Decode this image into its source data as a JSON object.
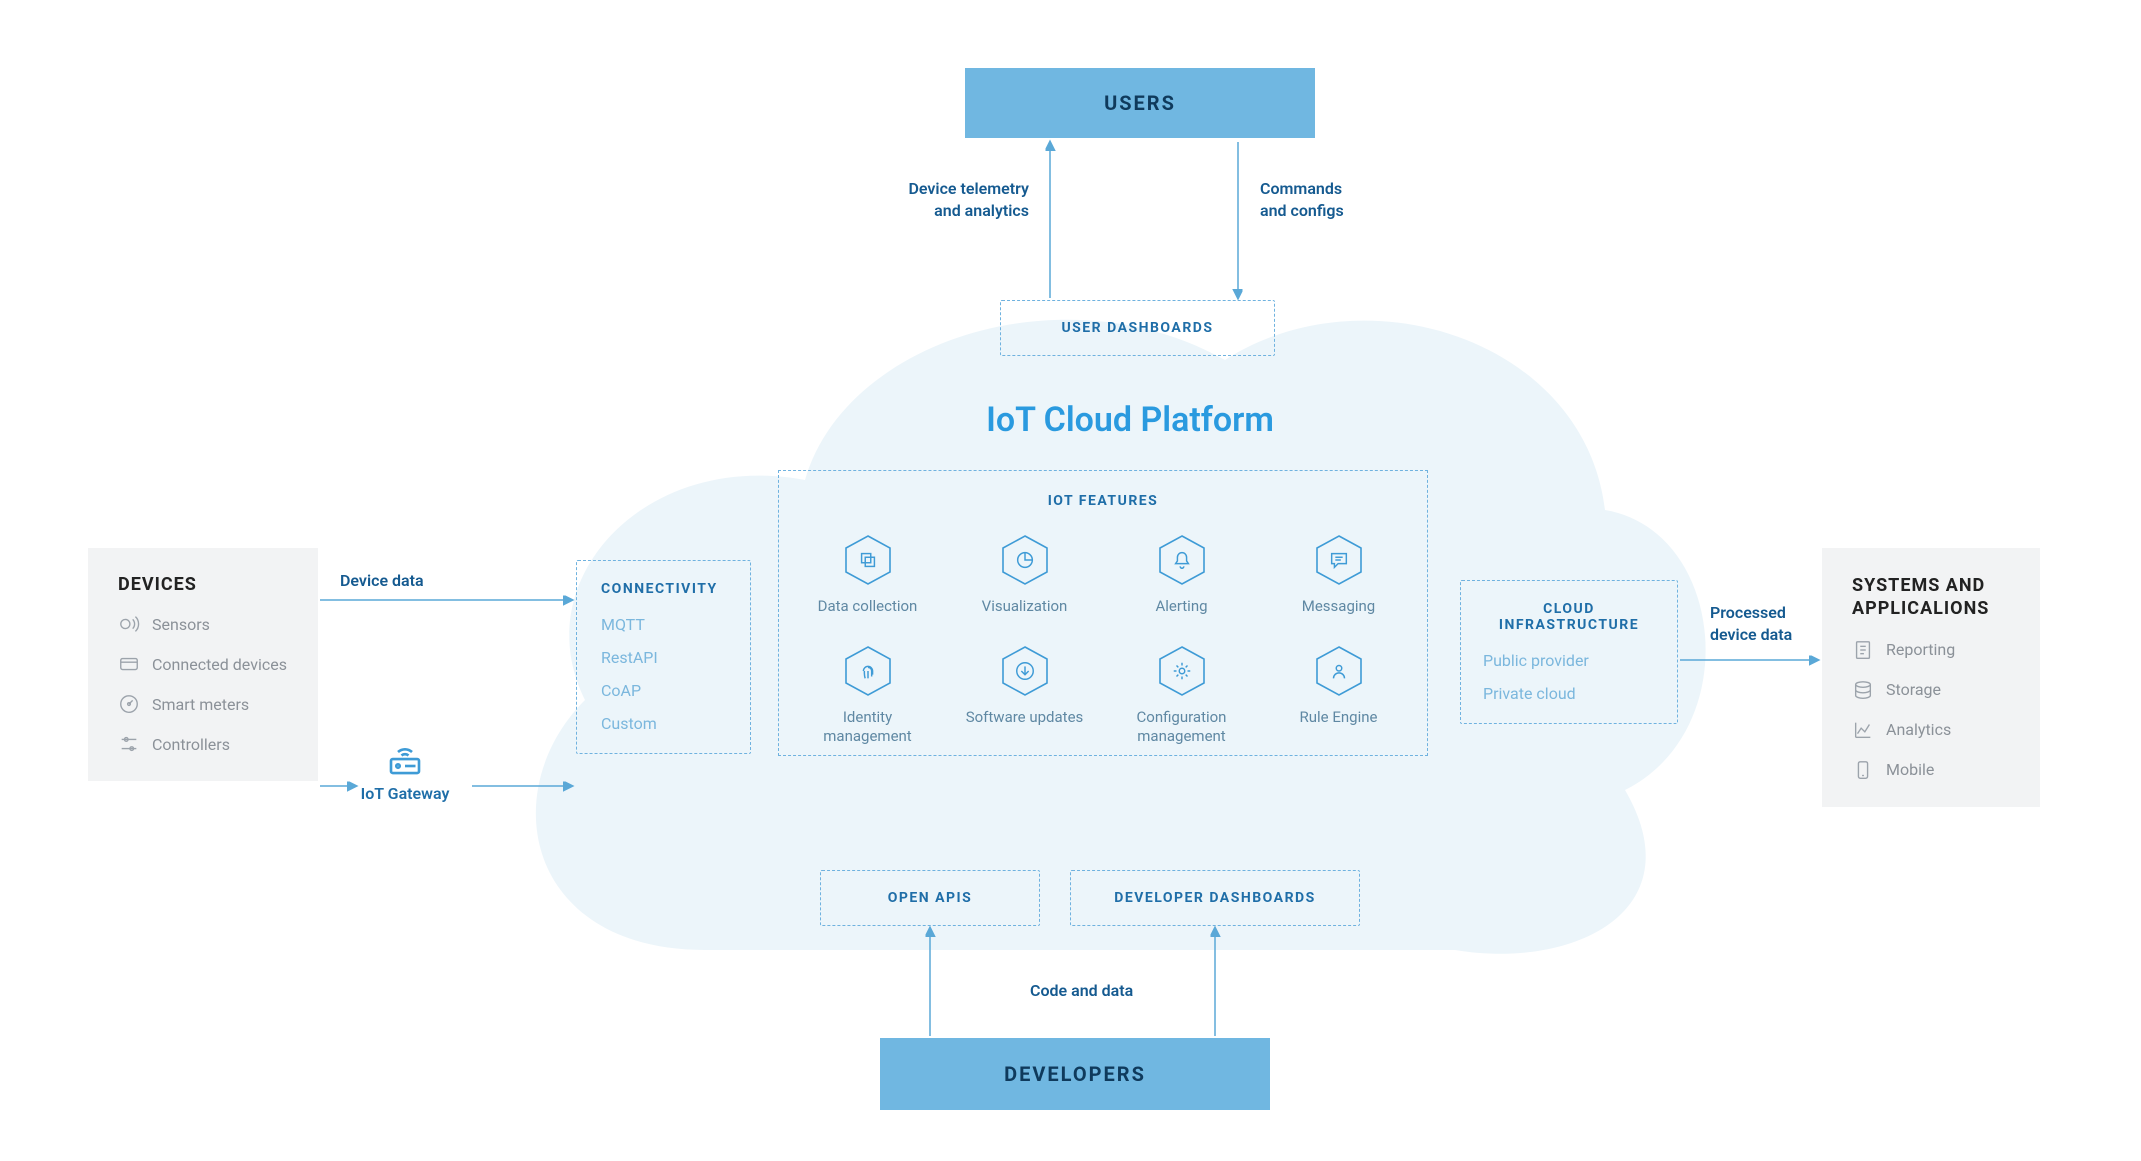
{
  "top": {
    "users_label": "USERS",
    "left_label": "Device telemetry\nand analytics",
    "right_label": "Commands\nand configs",
    "user_dashboards": "USER DASHBOARDS"
  },
  "platform_title": "IoT Cloud Platform",
  "devices": {
    "title": "DEVICES",
    "items": [
      "Sensors",
      "Connected devices",
      "Smart meters",
      "Controllers"
    ]
  },
  "gateway_label": "IoT Gateway",
  "arrows": {
    "device_data": "Device data",
    "processed": "Processed device data",
    "code_data": "Code and data"
  },
  "connectivity": {
    "title": "CONNECTIVITY",
    "items": [
      "MQTT",
      "RestAPI",
      "CoAP",
      "Custom"
    ]
  },
  "features": {
    "title": "IOT FEATURES",
    "items": [
      {
        "name": "Data collection",
        "icon": "stack"
      },
      {
        "name": "Visualization",
        "icon": "pie"
      },
      {
        "name": "Alerting",
        "icon": "bell"
      },
      {
        "name": "Messaging",
        "icon": "chat"
      },
      {
        "name": "Identity management",
        "icon": "fingerprint"
      },
      {
        "name": "Software updates",
        "icon": "download"
      },
      {
        "name": "Configuration management",
        "icon": "gear"
      },
      {
        "name": "Rule Engine",
        "icon": "user"
      }
    ]
  },
  "infra": {
    "title": "CLOUD INFRASTRUCTURE",
    "items": [
      "Public provider",
      "Private cloud"
    ]
  },
  "bottom": {
    "open_apis": "OPEN APIS",
    "dev_dashboards": "DEVELOPER DASHBOARDS",
    "developers": "DEVELOPERS"
  },
  "systems": {
    "title": "SYSTEMS AND APPLICALIONS",
    "items": [
      "Reporting",
      "Storage",
      "Analytics",
      "Mobile"
    ]
  }
}
